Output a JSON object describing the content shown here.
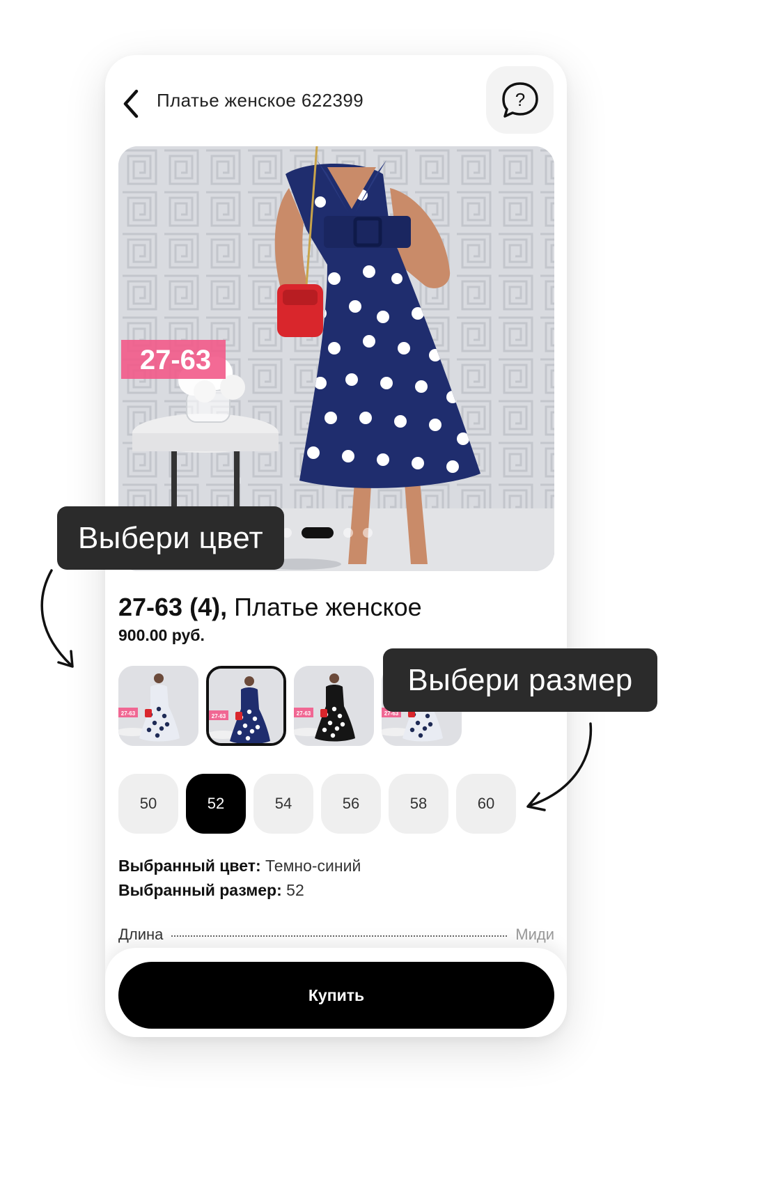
{
  "header": {
    "title": "Платье женское 622399"
  },
  "gallery": {
    "image_label": "27-63",
    "pages": 4,
    "active_page": 2
  },
  "product": {
    "code": "27-63 (4),",
    "name": "Платье женское",
    "price": "900.00 руб."
  },
  "colors": {
    "thumbs": [
      {
        "label": "27-63",
        "dress": "#e9ecf3",
        "dots": "#1e2a55"
      },
      {
        "label": "27-63",
        "dress": "#1f2d6e",
        "dots": "#ffffff"
      },
      {
        "label": "27-63",
        "dress": "#151515",
        "dots": "#ffffff"
      },
      {
        "label": "27-63",
        "dress": "#e9ecf3",
        "dots": "#1e2a55"
      }
    ],
    "selected_index": 1
  },
  "sizes": {
    "options": [
      "50",
      "52",
      "54",
      "56",
      "58",
      "60"
    ],
    "selected_index": 1
  },
  "selection": {
    "color_label": "Выбранный цвет:",
    "color_value": "Темно-синий",
    "size_label": "Выбранный размер:",
    "size_value": "52"
  },
  "specs": [
    {
      "key": "Длина",
      "value": "Миди"
    }
  ],
  "footer": {
    "buy_label": "Купить"
  },
  "callouts": {
    "color": "Выбери цвет",
    "size": "Выбери размер"
  },
  "colors_theme": {
    "accent": "#000000",
    "callout_bg": "#2b2b2b",
    "chip_bg": "#efefef",
    "badge_pink": "#f25a8a"
  }
}
